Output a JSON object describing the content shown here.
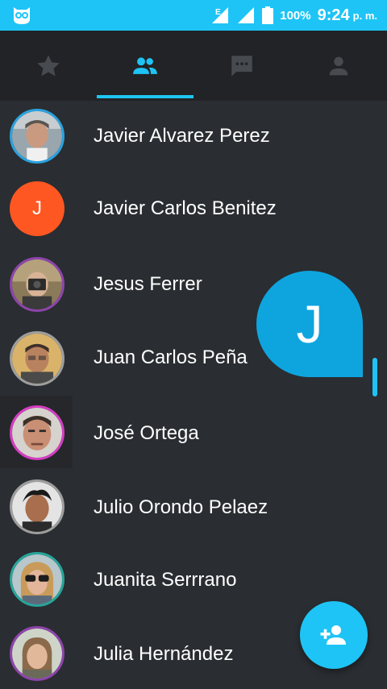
{
  "status_bar": {
    "network_label": "E",
    "battery": "100%",
    "time": "9:24",
    "ampm": "p. m.",
    "app_icon": "owl-icon"
  },
  "tabs": [
    {
      "icon": "star-icon",
      "active": false
    },
    {
      "icon": "people-icon",
      "active": true
    },
    {
      "icon": "chat-bubble-icon",
      "active": false
    },
    {
      "icon": "person-icon",
      "active": false
    }
  ],
  "contacts": [
    {
      "name": "Javier Alvarez Perez",
      "ring_color": "#29a3e0",
      "avatar_type": "photo"
    },
    {
      "name": "Javier Carlos Benitez",
      "avatar_type": "letter",
      "letter": "J",
      "color": "#ff5722"
    },
    {
      "name": "Jesus Ferrer",
      "ring_color": "#8e44ad",
      "avatar_type": "photo"
    },
    {
      "name": "Juan Carlos Peña",
      "ring_color": "#9e9e9e",
      "avatar_type": "photo"
    },
    {
      "name": "José Ortega",
      "ring_color": "#d63cc2",
      "avatar_type": "photo"
    },
    {
      "name": "Julio Orondo Pelaez",
      "ring_color": "#9e9e9e",
      "avatar_type": "photo"
    },
    {
      "name": "Juanita Serrrano",
      "ring_color": "#26a69a",
      "avatar_type": "photo"
    },
    {
      "name": "Julia Hernández",
      "ring_color": "#8e44ad",
      "avatar_type": "photo"
    }
  ],
  "fast_scroll_letter": "J",
  "fab": {
    "icon": "add-person-icon"
  },
  "colors": {
    "accent": "#1ec4f5",
    "background": "#2a2d31",
    "tab_bar": "#212326",
    "bubble": "#0ea5df"
  }
}
